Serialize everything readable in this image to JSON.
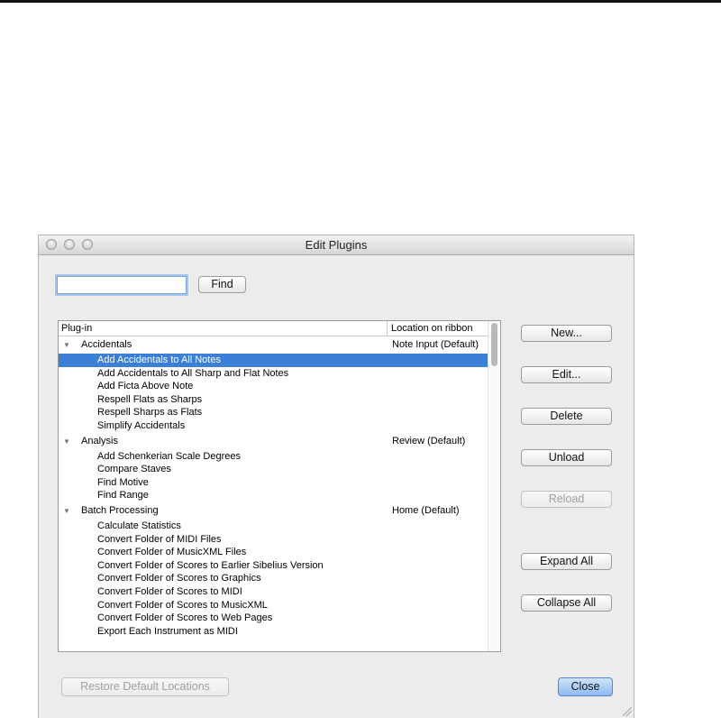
{
  "window": {
    "title": "Edit Plugins"
  },
  "search": {
    "value": "",
    "find_label": "Find"
  },
  "list": {
    "col_plugin": "Plug-in",
    "col_location": "Location on ribbon",
    "groups": [
      {
        "name": "Accidentals",
        "location": "Note Input (Default)",
        "items": [
          "Add Accidentals to All Notes",
          "Add Accidentals to All Sharp and Flat Notes",
          "Add Ficta Above Note",
          "Respell Flats as Sharps",
          "Respell Sharps as Flats",
          "Simplify Accidentals"
        ]
      },
      {
        "name": "Analysis",
        "location": "Review (Default)",
        "items": [
          "Add Schenkerian Scale Degrees",
          "Compare Staves",
          "Find Motive",
          "Find Range"
        ]
      },
      {
        "name": "Batch Processing",
        "location": "Home (Default)",
        "items": [
          "Calculate Statistics",
          "Convert Folder of MIDI Files",
          "Convert Folder of MusicXML Files",
          "Convert Folder of Scores to Earlier Sibelius Version",
          "Convert Folder of Scores to Graphics",
          "Convert Folder of Scores to MIDI",
          "Convert Folder of Scores to MusicXML",
          "Convert Folder of Scores to Web Pages",
          "Export Each Instrument as MIDI"
        ]
      }
    ],
    "selected_item": "Add Accidentals to All Notes"
  },
  "buttons": {
    "new": "New...",
    "edit": "Edit...",
    "delete": "Delete",
    "unload": "Unload",
    "reload": "Reload",
    "expand_all": "Expand All",
    "collapse_all": "Collapse All",
    "restore": "Restore Default Locations",
    "close": "Close"
  },
  "colors": {
    "selection": "#3b7fd6",
    "default_button": "#8dbaf0"
  },
  "icons": {
    "disclosure": "disclosure-triangle-icon",
    "window_controls": [
      "close-window-icon",
      "minimize-window-icon",
      "zoom-window-icon"
    ]
  }
}
